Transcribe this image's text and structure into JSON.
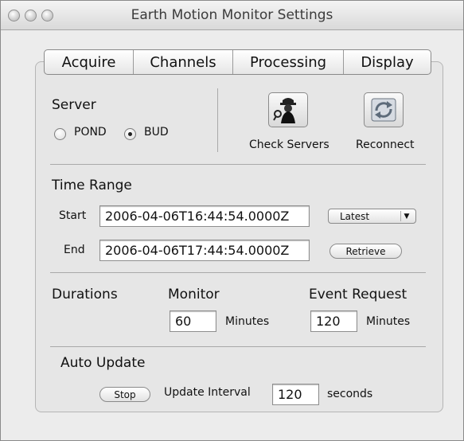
{
  "window": {
    "title": "Earth Motion Monitor Settings"
  },
  "tabs": [
    {
      "label": "Acquire"
    },
    {
      "label": "Channels"
    },
    {
      "label": "Processing"
    },
    {
      "label": "Display"
    }
  ],
  "server": {
    "heading": "Server",
    "options": [
      {
        "label": "POND",
        "selected": false
      },
      {
        "label": "BUD",
        "selected": true
      }
    ],
    "check_servers_label": "Check Servers",
    "reconnect_label": "Reconnect"
  },
  "time_range": {
    "heading": "Time Range",
    "start_label": "Start",
    "start_value": "2006-04-06T16:44:54.0000Z",
    "end_label": "End",
    "end_value": "2006-04-06T17:44:54.0000Z",
    "latest_label": "Latest",
    "retrieve_label": "Retrieve"
  },
  "durations": {
    "heading": "Durations",
    "monitor_label": "Monitor",
    "monitor_value": "60",
    "monitor_unit": "Minutes",
    "event_request_label": "Event Request",
    "event_request_value": "120",
    "event_request_unit": "Minutes"
  },
  "auto_update": {
    "heading": "Auto Update",
    "stop_label": "Stop",
    "interval_label": "Update Interval",
    "interval_value": "120",
    "interval_unit": "seconds"
  }
}
